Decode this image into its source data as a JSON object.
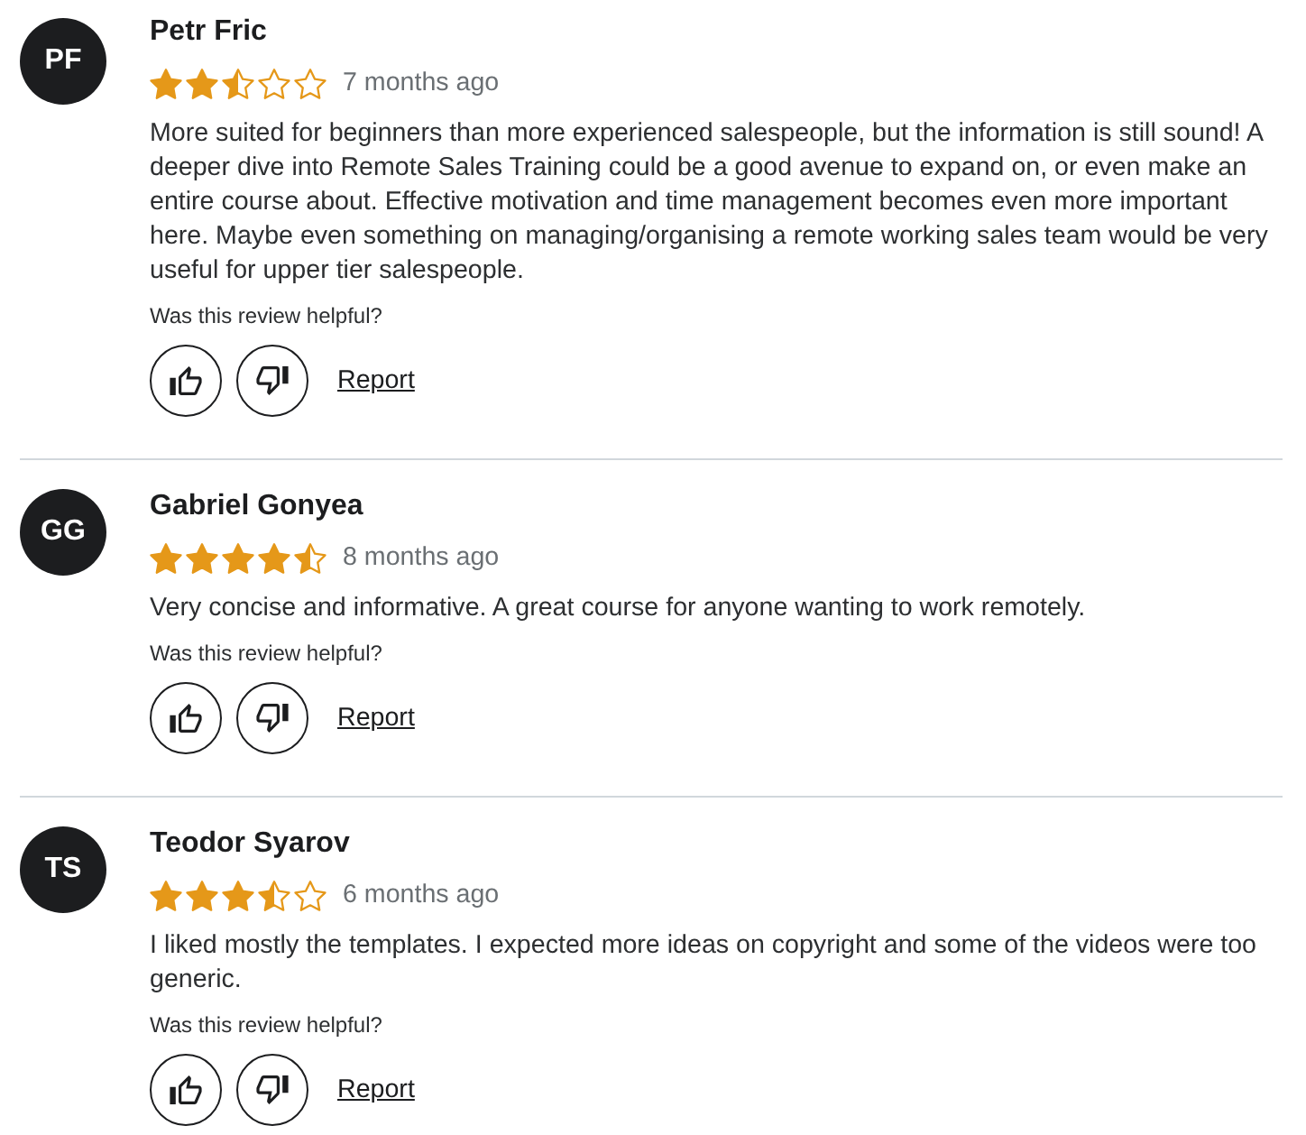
{
  "reviews": [
    {
      "initials": "PF",
      "name": "Petr Fric",
      "stars": 2.5,
      "time": "7 months ago",
      "text": "More suited for beginners than more experienced salespeople, but the information is still sound! A deeper dive into Remote Sales Training could be a good avenue to expand on, or even make an entire course about. Effective motivation and time management becomes even more important here. Maybe even something on managing/organising a remote working sales team would be very useful for upper tier salespeople.",
      "helpful_prompt": "Was this review helpful?",
      "report": "Report"
    },
    {
      "initials": "GG",
      "name": "Gabriel Gonyea",
      "stars": 4.5,
      "time": "8 months ago",
      "text": "Very concise and informative. A great course for anyone wanting to work remotely.",
      "helpful_prompt": "Was this review helpful?",
      "report": "Report"
    },
    {
      "initials": "TS",
      "name": "Teodor Syarov",
      "stars": 3.5,
      "time": "6 months ago",
      "text": "I liked mostly the templates. I expected more ideas on copyright and some of the videos were too generic.",
      "helpful_prompt": "Was this review helpful?",
      "report": "Report"
    }
  ]
}
